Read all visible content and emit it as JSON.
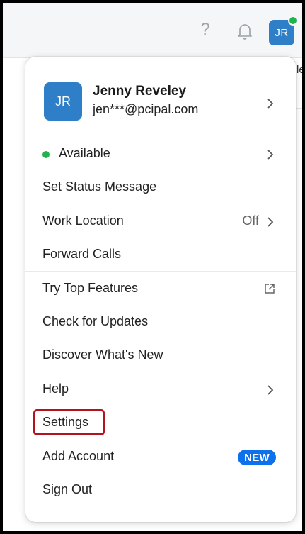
{
  "topbar": {
    "help_glyph": "?",
    "bell_icon": "bell-icon",
    "avatar_initials": "JR",
    "presence_color": "#22b24c",
    "background_fragment": "le"
  },
  "profile": {
    "initials": "JR",
    "name": "Jenny Reveley",
    "email": "jen***@pcipal.com"
  },
  "menu": {
    "status_label": "Available",
    "set_status_label": "Set Status Message",
    "work_location_label": "Work Location",
    "work_location_value": "Off",
    "forward_calls_label": "Forward Calls",
    "try_top_features_label": "Try Top Features",
    "check_updates_label": "Check for Updates",
    "whats_new_label": "Discover What's New",
    "help_label": "Help",
    "settings_label": "Settings",
    "add_account_label": "Add Account",
    "new_badge": "NEW",
    "sign_out_label": "Sign Out"
  },
  "colors": {
    "accent_blue": "#2e7fc7",
    "badge_blue": "#0e71eb",
    "available_green": "#22b24c",
    "highlight_red": "#b4121c"
  }
}
